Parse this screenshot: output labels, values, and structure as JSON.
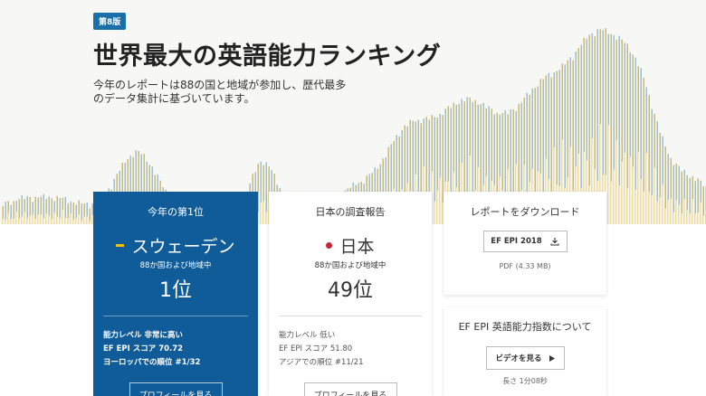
{
  "hero": {
    "badge": "第8版",
    "title": "世界最大の英語能力ランキング",
    "subtitle": "今年のレポートは88の国と地域が参加し、歴代最多のデータ集計に基づいています。"
  },
  "colors": {
    "primary": "#0f5c99",
    "badge": "#1a6fa8",
    "bar_blue": "#8fb0c8",
    "bar_yellow": "#efdc9c"
  },
  "top_card": {
    "heading": "今年の第1位",
    "country": "スウェーデン",
    "flag_icon": "sweden-flag-icon",
    "subtext": "88か国および地域中",
    "rank": "1位",
    "lines": [
      "能力レベル 非常に高い",
      "EF EPI スコア 70.72",
      "ヨーロッパでの順位 #1/32"
    ],
    "button": "プロフィールを見る"
  },
  "japan_card": {
    "heading": "日本の調査報告",
    "country": "日本",
    "flag_icon": "japan-flag-icon",
    "subtext": "88か国および地域中",
    "rank": "49位",
    "lines": [
      "能力レベル 低い",
      "EF EPI スコア 51.80",
      "アジアでの順位 #11/21"
    ],
    "button": "プロフィールを見る"
  },
  "download_card": {
    "heading": "レポートをダウンロード",
    "button": "EF EPI 2018",
    "button_icon": "download-icon",
    "file_info": "PDF (4.33 MB)"
  },
  "about_card": {
    "heading": "EF EPI 英語能力指数について",
    "button": "ビデオを見る",
    "button_icon": "play-icon",
    "duration": "長さ 1分08秒"
  }
}
